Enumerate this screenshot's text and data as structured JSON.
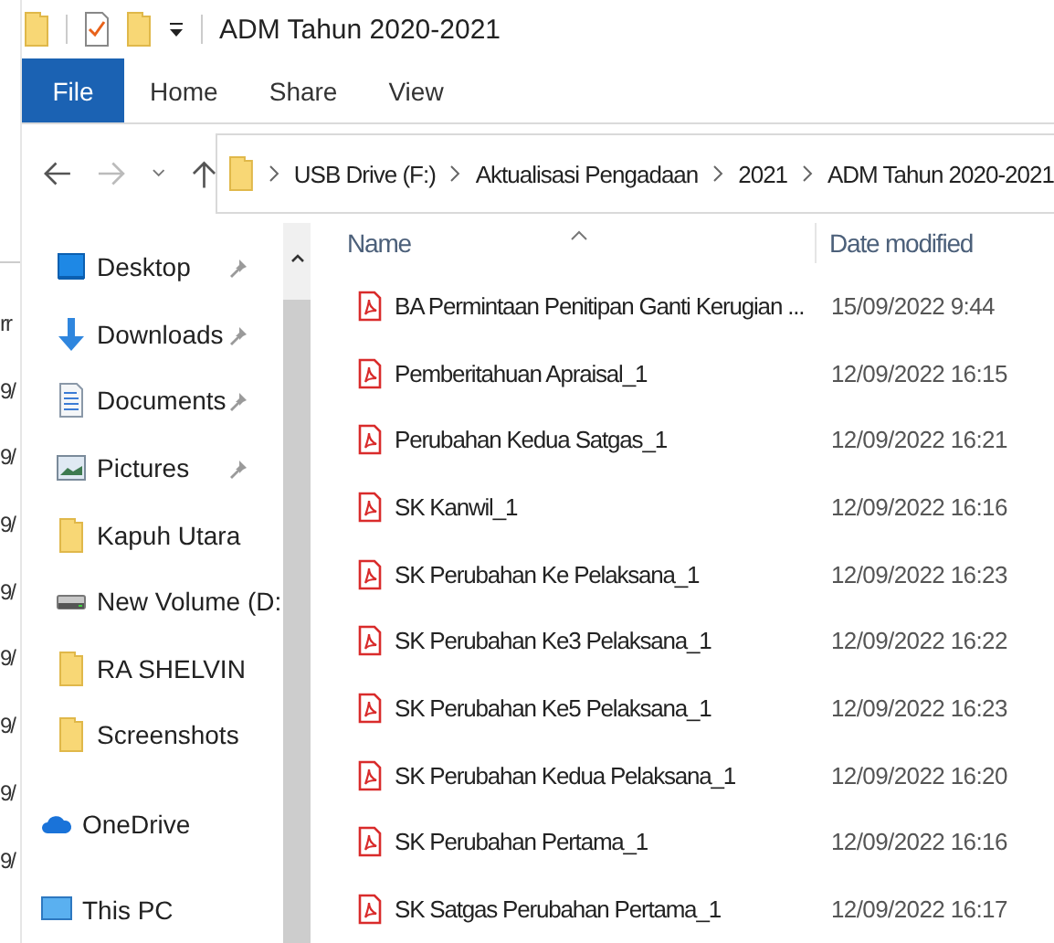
{
  "background_window": {
    "column_1": [
      "rr",
      "9/",
      "9/",
      "9/",
      "9/",
      "9/",
      "9/",
      "9/",
      "9/"
    ]
  },
  "window": {
    "title": "ADM Tahun 2020-2021"
  },
  "ribbon": {
    "file_menu": {
      "label": "File"
    },
    "tabs": [
      {
        "label": "Home",
        "selected": false
      },
      {
        "label": "Share",
        "selected": false
      },
      {
        "label": "View",
        "selected": false
      }
    ]
  },
  "address_bar": {
    "breadcrumbs": [
      "USB Drive (F:)",
      "Aktualisasi Pengadaan",
      "2021",
      "ADM Tahun 2020-2021"
    ]
  },
  "navigation_pane": {
    "items": [
      {
        "label": "Desktop",
        "kind": "desktop",
        "pinned": true
      },
      {
        "label": "Downloads",
        "kind": "downloads",
        "pinned": true
      },
      {
        "label": "Documents",
        "kind": "documents",
        "pinned": true
      },
      {
        "label": "Pictures",
        "kind": "pictures",
        "pinned": true
      },
      {
        "label": "Kapuh Utara",
        "kind": "folder",
        "pinned": false
      },
      {
        "label": "New Volume (D:",
        "kind": "drive",
        "pinned": false
      },
      {
        "label": "RA SHELVIN",
        "kind": "folder",
        "pinned": false
      },
      {
        "label": "Screenshots",
        "kind": "folder",
        "pinned": false
      },
      {
        "label": "OneDrive",
        "kind": "onedrive",
        "pinned": false
      },
      {
        "label": "This PC",
        "kind": "pc",
        "pinned": false
      }
    ]
  },
  "file_list": {
    "columns": [
      {
        "label": "Name",
        "sorted": true
      },
      {
        "label": "Date modified",
        "sorted": false
      }
    ],
    "rows": [
      {
        "name": "BA Permintaan Penitipan Ganti Kerugian ...",
        "date_modified": "15/09/2022 9:44"
      },
      {
        "name": "Pemberitahuan Apraisal_1",
        "date_modified": "12/09/2022 16:15"
      },
      {
        "name": "Perubahan Kedua Satgas_1",
        "date_modified": "12/09/2022 16:21"
      },
      {
        "name": "SK Kanwil_1",
        "date_modified": "12/09/2022 16:16"
      },
      {
        "name": "SK Perubahan Ke Pelaksana_1",
        "date_modified": "12/09/2022 16:23"
      },
      {
        "name": "SK Perubahan Ke3 Pelaksana_1",
        "date_modified": "12/09/2022 16:22"
      },
      {
        "name": "SK Perubahan Ke5 Pelaksana_1",
        "date_modified": "12/09/2022 16:23"
      },
      {
        "name": "SK Perubahan Kedua Pelaksana_1",
        "date_modified": "12/09/2022 16:20"
      },
      {
        "name": "SK Perubahan Pertama_1",
        "date_modified": "12/09/2022 16:16"
      },
      {
        "name": "SK Satgas Perubahan Pertama_1",
        "date_modified": "12/09/2022 16:17"
      }
    ]
  }
}
